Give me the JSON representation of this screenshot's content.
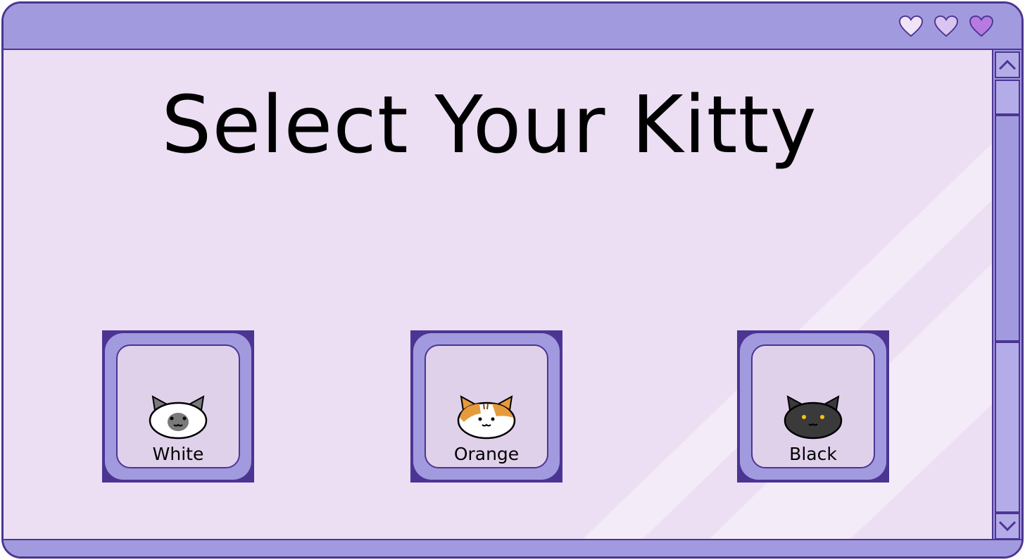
{
  "title": "Select Your Kitty",
  "titlebar": {
    "hearts": [
      {
        "icon": "heart-icon",
        "color": "#f0e4f6"
      },
      {
        "icon": "heart-icon",
        "color": "#d9c5f0"
      },
      {
        "icon": "heart-icon",
        "color": "#b77ae0"
      }
    ]
  },
  "choices": [
    {
      "label": "White",
      "icon": "white-cat-icon"
    },
    {
      "label": "Orange",
      "icon": "orange-cat-icon"
    },
    {
      "label": "Black",
      "icon": "black-cat-icon"
    }
  ],
  "scrollbar": {
    "up_icon": "chevron-up-icon",
    "down_icon": "chevron-down-icon"
  },
  "colors": {
    "frame": "#4b3592",
    "bar": "#a29ade",
    "background": "#ecdff3",
    "tile_inner": "#e0d1ea"
  }
}
